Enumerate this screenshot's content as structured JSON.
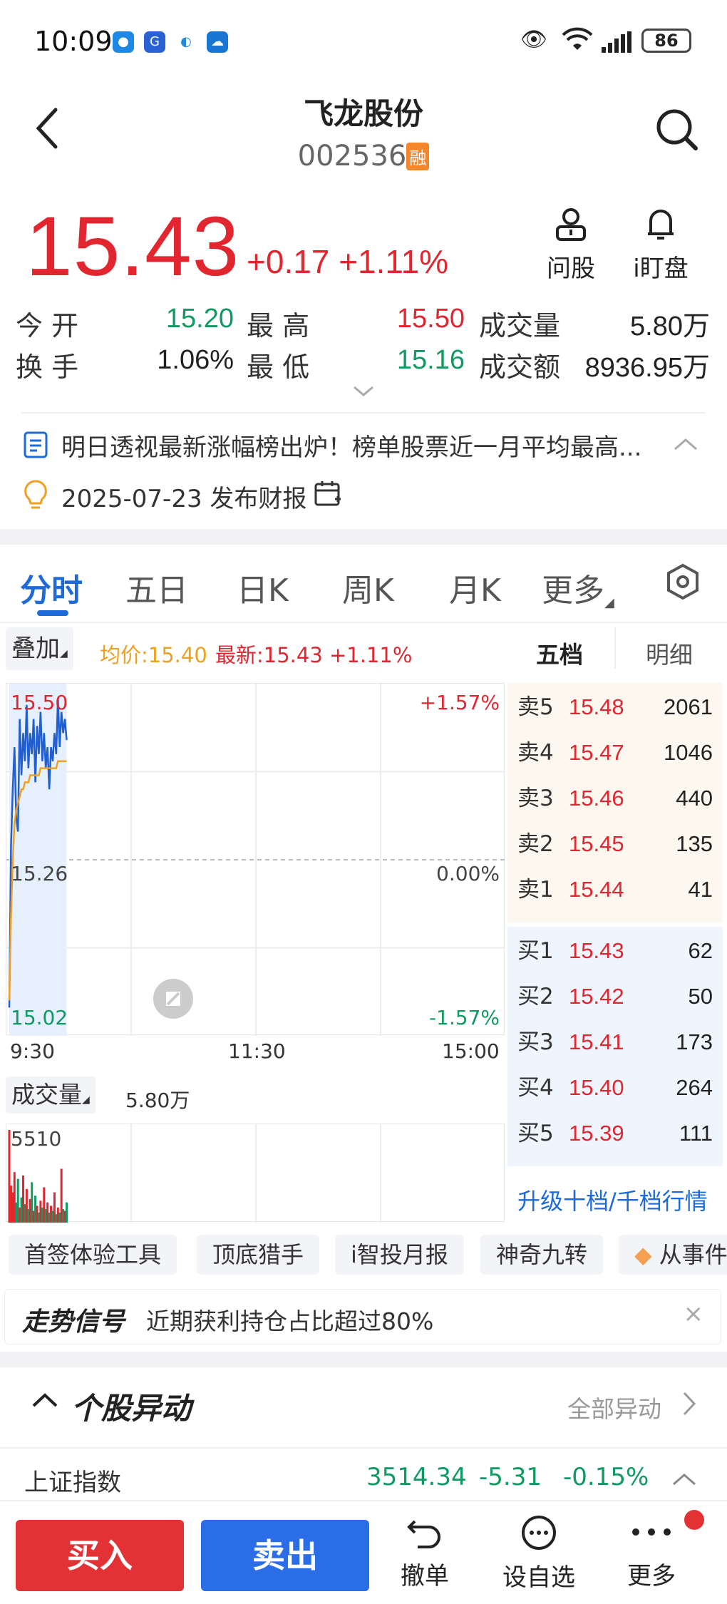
{
  "status": {
    "time": "10:09",
    "battery": "86"
  },
  "header": {
    "title": "飞龙股份",
    "code": "002536",
    "badge": "融"
  },
  "quote": {
    "price": "15.43",
    "change": "+0.17",
    "change_pct": "+1.11%",
    "ask_label": "问股",
    "watch_label": "i盯盘",
    "stats": [
      {
        "label": "今  开",
        "value": "15.20",
        "color": "green"
      },
      {
        "label": "最  高",
        "value": "15.50",
        "color": "red"
      },
      {
        "label": "成交量",
        "value": "5.80万",
        "color": "dark"
      },
      {
        "label": "换  手",
        "value": "1.06%",
        "color": "dark"
      },
      {
        "label": "最  低",
        "value": "15.16",
        "color": "green"
      },
      {
        "label": "成交额",
        "value": "8936.95万",
        "color": "dark"
      }
    ]
  },
  "news": {
    "headline": "明日透视最新涨幅榜出炉！榜单股票近一月平均最高...",
    "report": "2025-07-23 发布财报"
  },
  "tabs": [
    "分时",
    "五日",
    "日K",
    "周K",
    "月K",
    "更多"
  ],
  "chart_toolbar": {
    "overlay": "叠加",
    "avg": "均价:15.40",
    "latest": "最新:15.43 +1.11%",
    "orderbook_tab": "五档",
    "detail_tab": "明细"
  },
  "chart_data": {
    "type": "line",
    "title": "",
    "y_left_labels": [
      "15.50",
      "15.26",
      "15.02"
    ],
    "y_right_labels": [
      "+1.57%",
      "0.00%",
      "-1.57%"
    ],
    "x_labels": [
      "9:30",
      "11:30",
      "15:00"
    ],
    "ylim": [
      15.02,
      15.5
    ],
    "prev_close": 15.26,
    "series": [
      {
        "name": "最新",
        "values": [
          15.05,
          15.28,
          15.36,
          15.42,
          15.32,
          15.3,
          15.46,
          15.38,
          15.44,
          15.4,
          15.48,
          15.39,
          15.44,
          15.41,
          15.46,
          15.37,
          15.45,
          15.41,
          15.47,
          15.4,
          15.44,
          15.39,
          15.42,
          15.36,
          15.42,
          15.4,
          15.44,
          15.41,
          15.49,
          15.42,
          15.47,
          15.44,
          15.46,
          15.43
        ]
      },
      {
        "name": "均价",
        "values": [
          15.06,
          15.18,
          15.26,
          15.31,
          15.33,
          15.34,
          15.35,
          15.36,
          15.36,
          15.37,
          15.37,
          15.37,
          15.38,
          15.38,
          15.38,
          15.38,
          15.38,
          15.38,
          15.39,
          15.39,
          15.39,
          15.39,
          15.39,
          15.39,
          15.39,
          15.39,
          15.39,
          15.39,
          15.4,
          15.4,
          15.4,
          15.4,
          15.4,
          15.4
        ]
      }
    ],
    "volume": {
      "label": "成交量",
      "total": "5.80万",
      "max_label": "5510",
      "values": [
        5510,
        2200,
        1800,
        3000,
        1200,
        2600,
        900,
        1500,
        2800,
        1100,
        2000,
        800,
        1400,
        2400,
        700,
        1600,
        1000,
        600,
        1300,
        900,
        2100,
        800,
        1200,
        600,
        1000,
        700,
        1800,
        500,
        900,
        600,
        3200,
        800,
        700,
        1200
      ]
    }
  },
  "orderbook": {
    "sell": [
      {
        "label": "卖5",
        "price": "15.48",
        "vol": "2061"
      },
      {
        "label": "卖4",
        "price": "15.47",
        "vol": "1046"
      },
      {
        "label": "卖3",
        "price": "15.46",
        "vol": "440"
      },
      {
        "label": "卖2",
        "price": "15.45",
        "vol": "135"
      },
      {
        "label": "卖1",
        "price": "15.44",
        "vol": "41"
      }
    ],
    "buy": [
      {
        "label": "买1",
        "price": "15.43",
        "vol": "62"
      },
      {
        "label": "买2",
        "price": "15.42",
        "vol": "50"
      },
      {
        "label": "买3",
        "price": "15.41",
        "vol": "173"
      },
      {
        "label": "买4",
        "price": "15.40",
        "vol": "264"
      },
      {
        "label": "买5",
        "price": "15.39",
        "vol": "111"
      }
    ],
    "upgrade": "升级十档/千档行情"
  },
  "tools": [
    "首签体验工具",
    "顶底猎手",
    "i智投月报",
    "神奇九转",
    "从事件"
  ],
  "signal": {
    "title": "走势信号",
    "text": "近期获利持仓占比超过80%"
  },
  "movement": {
    "title": "个股异动",
    "all": "全部异动"
  },
  "index": {
    "name": "上证指数",
    "value": "3514.34",
    "change": "-5.31",
    "pct": "-0.15%"
  },
  "footer": {
    "buy": "买入",
    "sell": "卖出",
    "cancel": "撤单",
    "watchlist": "设自选",
    "more": "更多"
  }
}
